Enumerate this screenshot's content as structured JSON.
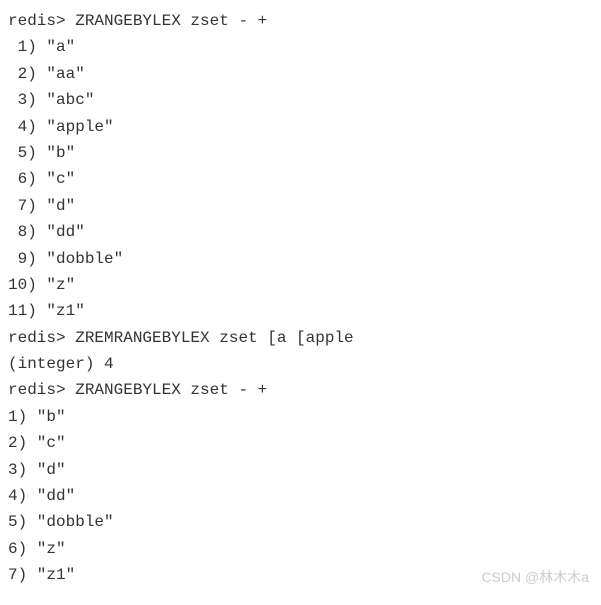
{
  "session": {
    "prompt": "redis>",
    "commands": [
      {
        "cmd": "ZRANGEBYLEX zset - +",
        "result_type": "list",
        "pad_width": 2,
        "list": [
          "a",
          "aa",
          "abc",
          "apple",
          "b",
          "c",
          "d",
          "dd",
          "dobble",
          "z",
          "z1"
        ]
      },
      {
        "cmd": "ZREMRANGEBYLEX zset [a [apple",
        "result_type": "integer",
        "integer": 4
      },
      {
        "cmd": "ZRANGEBYLEX zset - +",
        "result_type": "list",
        "pad_width": 1,
        "list": [
          "b",
          "c",
          "d",
          "dd",
          "dobble",
          "z",
          "z1"
        ]
      }
    ]
  },
  "watermark": "CSDN @林木木a"
}
